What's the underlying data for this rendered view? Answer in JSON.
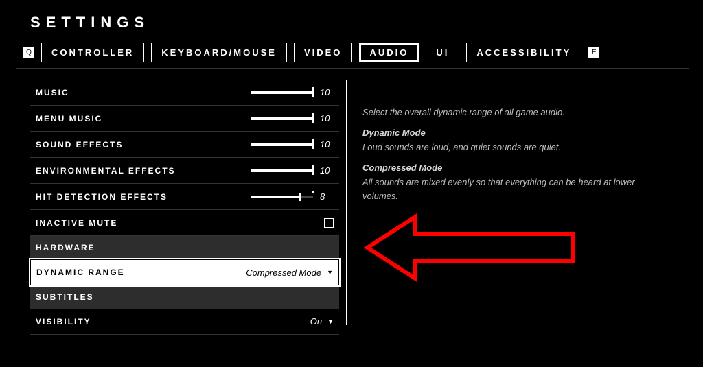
{
  "title": "SETTINGS",
  "bumpers": {
    "left": "Q",
    "right": "E"
  },
  "tabs": [
    {
      "label": "CONTROLLER",
      "active": false
    },
    {
      "label": "KEYBOARD/MOUSE",
      "active": false
    },
    {
      "label": "VIDEO",
      "active": false
    },
    {
      "label": "AUDIO",
      "active": true
    },
    {
      "label": "UI",
      "active": false
    },
    {
      "label": "ACCESSIBILITY",
      "active": false
    }
  ],
  "sliders": [
    {
      "label": "MUSIC",
      "value": 10,
      "max": 10
    },
    {
      "label": "MENU MUSIC",
      "value": 10,
      "max": 10
    },
    {
      "label": "SOUND EFFECTS",
      "value": 10,
      "max": 10
    },
    {
      "label": "ENVIRONMENTAL EFFECTS",
      "value": 10,
      "max": 10
    },
    {
      "label": "HIT DETECTION EFFECTS",
      "value": 8,
      "max": 10
    }
  ],
  "inactive_mute": {
    "label": "INACTIVE MUTE",
    "checked": false
  },
  "sections": {
    "hardware": "HARDWARE",
    "subtitles": "SUBTITLES"
  },
  "dynamic_range": {
    "label": "DYNAMIC RANGE",
    "value": "Compressed Mode"
  },
  "visibility": {
    "label": "VISIBILITY",
    "value": "On"
  },
  "help": {
    "intro": "Select the overall dynamic range of all game audio.",
    "mode1_title": "Dynamic Mode",
    "mode1_body": "Loud sounds are loud, and quiet sounds are quiet.",
    "mode2_title": "Compressed Mode",
    "mode2_body": "All sounds are mixed evenly so that everything can be heard at lower volumes."
  },
  "colors": {
    "annotation": "#ff0000"
  }
}
